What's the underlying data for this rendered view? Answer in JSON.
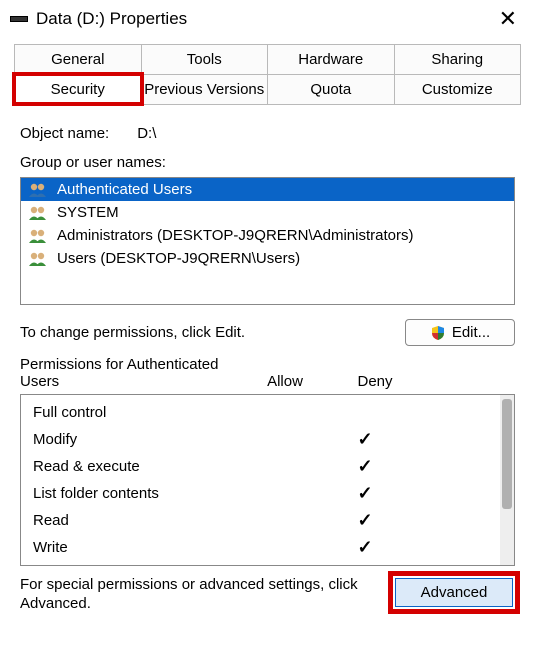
{
  "window": {
    "title": "Data (D:) Properties"
  },
  "tabs": {
    "row1": [
      "General",
      "Tools",
      "Hardware",
      "Sharing"
    ],
    "row2": [
      "Security",
      "Previous Versions",
      "Quota",
      "Customize"
    ],
    "active": "Security"
  },
  "object": {
    "label": "Object name:",
    "value": "D:\\"
  },
  "groups": {
    "label": "Group or user names:",
    "items": [
      {
        "name": "Authenticated Users",
        "selected": true
      },
      {
        "name": "SYSTEM",
        "selected": false
      },
      {
        "name": "Administrators (DESKTOP-J9QRERN\\Administrators)",
        "selected": false
      },
      {
        "name": "Users (DESKTOP-J9QRERN\\Users)",
        "selected": false
      }
    ]
  },
  "edit": {
    "text": "To change permissions, click Edit.",
    "button": "Edit..."
  },
  "permissions": {
    "label": "Permissions for Authenticated Users",
    "allow_label": "Allow",
    "deny_label": "Deny",
    "rows": [
      {
        "name": "Full control",
        "allow": false,
        "deny": false
      },
      {
        "name": "Modify",
        "allow": true,
        "deny": false
      },
      {
        "name": "Read & execute",
        "allow": true,
        "deny": false
      },
      {
        "name": "List folder contents",
        "allow": true,
        "deny": false
      },
      {
        "name": "Read",
        "allow": true,
        "deny": false
      },
      {
        "name": "Write",
        "allow": true,
        "deny": false
      }
    ]
  },
  "advanced": {
    "text": "For special permissions or advanced settings, click Advanced.",
    "button": "Advanced"
  }
}
